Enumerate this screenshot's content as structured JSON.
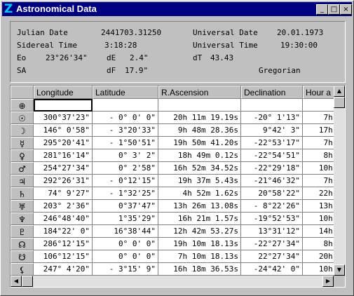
{
  "window": {
    "title": "Astronomical Data",
    "logo_glyph": "Z",
    "minimize_glyph": "_",
    "maximize_glyph": "□",
    "close_glyph": "×"
  },
  "info": {
    "julian_date_label": "Julian Date",
    "julian_date": "2441703.31250",
    "universal_date_label": "Universal Date",
    "universal_date": "20.01.1973",
    "sidereal_time_label": "Sidereal Time",
    "sidereal_time": "3:18:28",
    "universal_time_label": "Universal Time",
    "universal_time": "19:30:00",
    "eo_label": "Eo",
    "eo": "23°26'34\"",
    "de_label": "dE",
    "de": "2.4\"",
    "dt_label": "dT",
    "dt": "43.43",
    "sa_label": "SA",
    "df_label": "dF",
    "df": "17.9\"",
    "calendar": "Gregorian"
  },
  "table": {
    "headers": [
      "Longitude",
      "Latitude",
      "R.Ascension",
      "Declination",
      "Hour a"
    ],
    "header_symbol": "⊕",
    "rows": [
      {
        "symbol": "☉",
        "lon": "300°37'23\"",
        "lat": "- 0° 0' 0\"",
        "ra": "20h 11m 19.19s",
        "dec": "-20° 1'13\"",
        "ha": "7h 0"
      },
      {
        "symbol": "☽",
        "lon": "146° 0'58\"",
        "lat": "- 3°20'33\"",
        "ra": "9h 48m 28.36s",
        "dec": "9°42' 3\"",
        "ha": "17h 2"
      },
      {
        "symbol": "☿",
        "lon": "295°20'41\"",
        "lat": "- 1°50'51\"",
        "ra": "19h 50m 41.20s",
        "dec": "-22°53'17\"",
        "ha": "7h 2"
      },
      {
        "symbol": "♀",
        "lon": "281°16'14\"",
        "lat": "0° 3' 2\"",
        "ra": "18h 49m 0.12s",
        "dec": "-22°54'51\"",
        "ha": "8h 2"
      },
      {
        "symbol": "♂",
        "lon": "254°27'34\"",
        "lat": "0° 2'58\"",
        "ra": "16h 52m 34.52s",
        "dec": "-22°29'18\"",
        "ha": "10h 2"
      },
      {
        "symbol": "♃",
        "lon": "292°26'31\"",
        "lat": "- 0°12'15\"",
        "ra": "19h 37m 5.43s",
        "dec": "-21°46'32\"",
        "ha": "7h 4"
      },
      {
        "symbol": "♄",
        "lon": "74° 9'27\"",
        "lat": "- 1°32'25\"",
        "ra": "4h 52m 1.62s",
        "dec": "20°58'22\"",
        "ha": "22h 2"
      },
      {
        "symbol": "♅",
        "lon": "203° 2'36\"",
        "lat": "0°37'47\"",
        "ra": "13h 26m 13.08s",
        "dec": "- 8°22'26\"",
        "ha": "13h 5"
      },
      {
        "symbol": "♆",
        "lon": "246°48'40\"",
        "lat": "1°35'29\"",
        "ra": "16h 21m 1.57s",
        "dec": "-19°52'53\"",
        "ha": "10h 5"
      },
      {
        "symbol": "♇",
        "lon": "184°22' 0\"",
        "lat": "16°38'44\"",
        "ra": "12h 42m 53.27s",
        "dec": "13°31'12\"",
        "ha": "14h 3"
      },
      {
        "symbol": "☊",
        "lon": "286°12'15\"",
        "lat": "0° 0' 0\"",
        "ra": "19h 10m 18.13s",
        "dec": "-22°27'34\"",
        "ha": "8h 0"
      },
      {
        "symbol": "☋",
        "lon": "106°12'15\"",
        "lat": "0° 0' 0\"",
        "ra": "7h 10m 18.13s",
        "dec": "22°27'34\"",
        "ha": "20h 0"
      },
      {
        "symbol": "⚸",
        "lon": "247° 4'20\"",
        "lat": "- 3°15' 9\"",
        "ra": "16h 18m 36.53s",
        "dec": "-24°42' 0\"",
        "ha": "10h 5"
      }
    ]
  },
  "scrollbar": {
    "up": "▲",
    "down": "▼",
    "left": "◀",
    "right": "▶"
  }
}
